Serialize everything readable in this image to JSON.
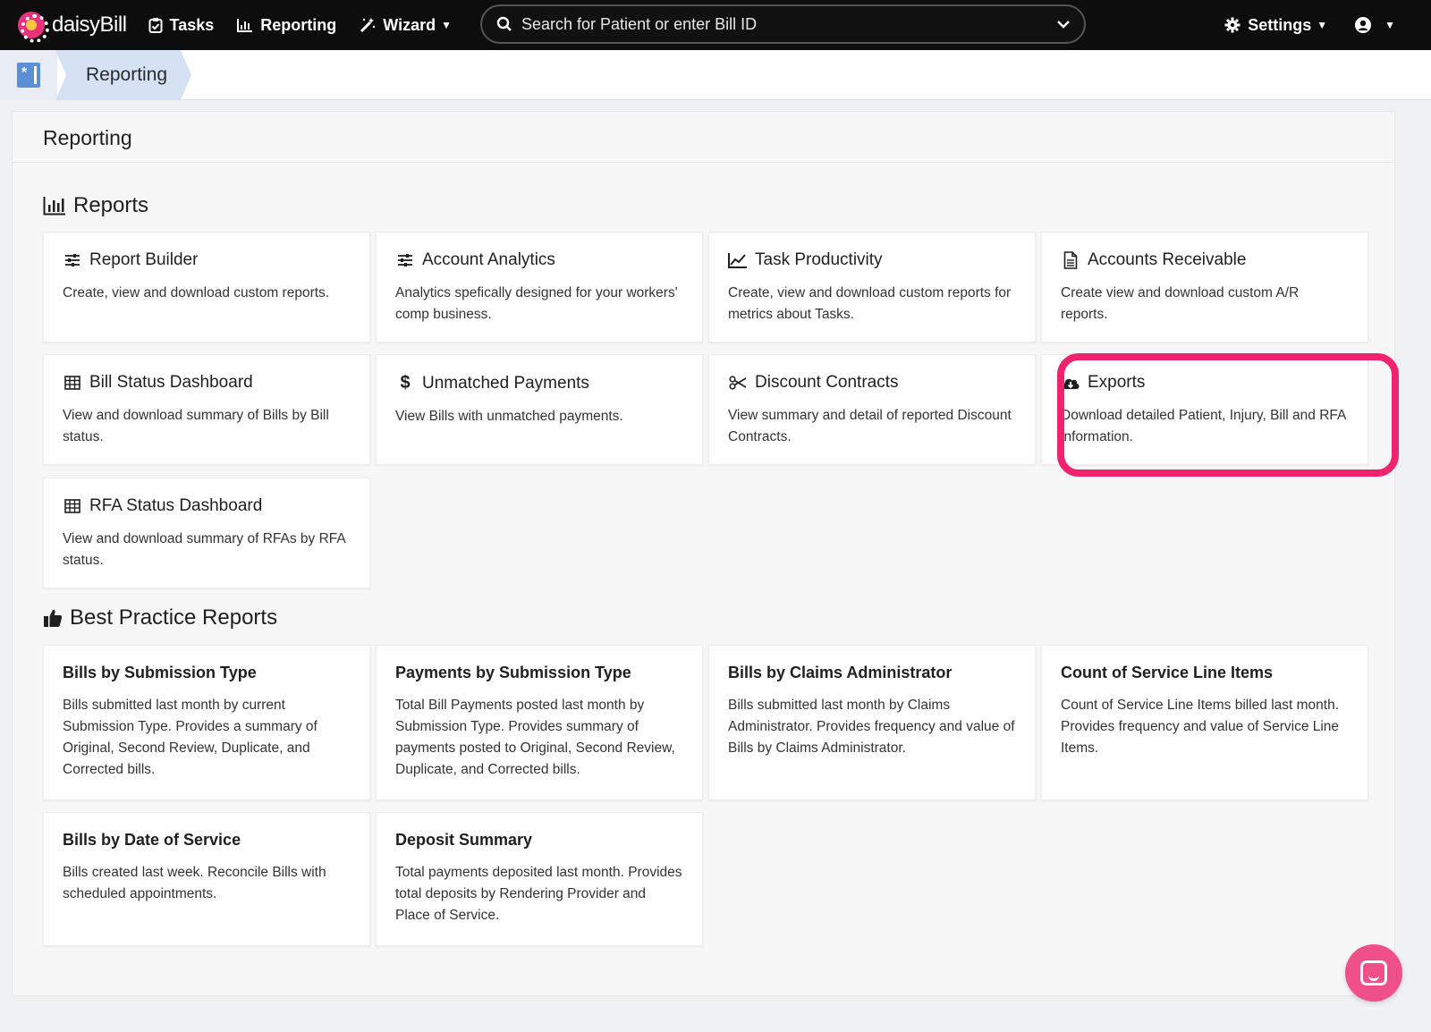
{
  "navbar": {
    "brand": "daisyBill",
    "tasks_label": "Tasks",
    "reporting_label": "Reporting",
    "wizard_label": "Wizard",
    "search_placeholder": "Search for Patient or enter Bill ID",
    "settings_label": "Settings"
  },
  "breadcrumb": {
    "current": "Reporting"
  },
  "page": {
    "title": "Reporting"
  },
  "reports": {
    "heading": "Reports",
    "cards": [
      {
        "title": "Report Builder",
        "desc": "Create, view and download custom reports.",
        "icon": "sliders-icon"
      },
      {
        "title": "Account Analytics",
        "desc": "Analytics spefically designed for your workers' comp business.",
        "icon": "sliders-icon"
      },
      {
        "title": "Task Productivity",
        "desc": "Create, view and download custom reports for metrics about Tasks.",
        "icon": "line-chart-icon"
      },
      {
        "title": "Accounts Receivable",
        "desc": "Create view and download custom A/R reports.",
        "icon": "document-icon"
      },
      {
        "title": "Bill Status Dashboard",
        "desc": "View and download summary of Bills by Bill status.",
        "icon": "table-icon"
      },
      {
        "title": "Unmatched Payments",
        "desc": "View Bills with unmatched payments.",
        "icon": "dollar-icon"
      },
      {
        "title": "Discount Contracts",
        "desc": "View summary and detail of reported Discount Contracts.",
        "icon": "scissors-icon"
      },
      {
        "title": "Exports",
        "desc": "Download detailed Patient, Injury, Bill and RFA information.",
        "icon": "cloud-download-icon"
      },
      {
        "title": "RFA Status Dashboard",
        "desc": "View and download summary of RFAs by RFA status.",
        "icon": "table-icon"
      }
    ]
  },
  "best_practice": {
    "heading": "Best Practice Reports",
    "cards": [
      {
        "title": "Bills by Submission Type",
        "desc": "Bills submitted last month by current Submission Type. Provides a summary of Original, Second Review, Duplicate, and Corrected bills."
      },
      {
        "title": "Payments by Submission Type",
        "desc": "Total Bill Payments posted last month by Submission Type. Provides summary of payments posted to Original, Second Review, Duplicate, and Corrected bills."
      },
      {
        "title": "Bills by Claims Administrator",
        "desc": "Bills submitted last month by Claims Administrator. Provides frequency and value of Bills by Claims Administrator."
      },
      {
        "title": "Count of Service Line Items",
        "desc": "Count of Service Line Items billed last month. Provides frequency and value of Service Line Items."
      },
      {
        "title": "Bills by Date of Service",
        "desc": "Bills created last week. Reconcile Bills with scheduled appointments."
      },
      {
        "title": "Deposit Summary",
        "desc": "Total payments deposited last month. Provides total deposits by Rendering Provider and Place of Service."
      }
    ]
  },
  "colors": {
    "highlight": "#f0246e",
    "accent": "#e8317a",
    "navbar": "#0d0d0d",
    "breadcrumb": "#d4e2f3"
  }
}
